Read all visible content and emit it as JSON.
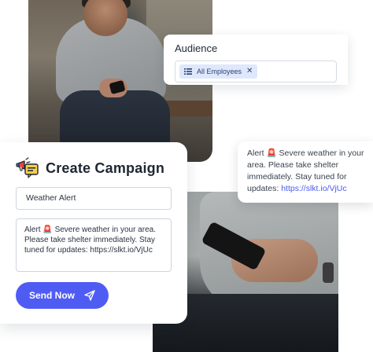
{
  "audience": {
    "title": "Audience",
    "chip_label": "All Employees",
    "chip_icon": "list-icon",
    "remove_icon": "close-icon",
    "remove_glyph": "✕"
  },
  "sms_preview": {
    "prefix": "Alert ",
    "alert_glyph": "🚨",
    "body": " Severe weather in your area. Please take shelter immediately. Stay tuned for updates: ",
    "link": "https://slkt.io/VjUc"
  },
  "campaign": {
    "title": "Create Campaign",
    "icon": "megaphone-icon",
    "title_input_value": "Weather Alert",
    "message_prefix": "Alert ",
    "message_glyph": "🚨",
    "message_body": " Severe weather in your area. Please take shelter immediately. Stay tuned for updates: https://slkt.io/VjUc",
    "send_label": "Send Now",
    "send_icon": "paper-plane-icon"
  },
  "colors": {
    "primary": "#4f5cf3",
    "chip_bg": "#dfe8fb",
    "link": "#4a5bf0"
  }
}
